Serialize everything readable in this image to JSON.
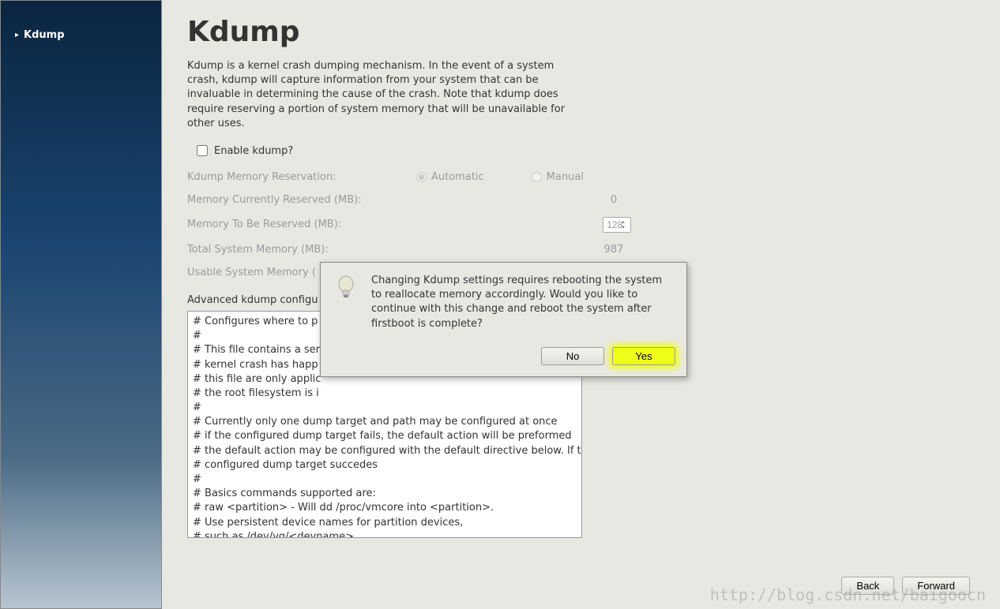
{
  "sidebar": {
    "items": [
      {
        "label": "Kdump"
      }
    ]
  },
  "page": {
    "title": "Kdump",
    "description": "Kdump is a kernel crash dumping mechanism. In the event of a system crash, kdump will capture information from your system that can be invaluable in determining the cause of the crash. Note that kdump does require reserving a portion of system memory that will be unavailable for other uses.",
    "enable_label": "Enable kdump?",
    "rows": {
      "reservation_label": "Kdump Memory Reservation:",
      "auto_label": "Automatic",
      "manual_label": "Manual",
      "current_reserved_label": "Memory Currently Reserved (MB):",
      "current_reserved_value": "0",
      "to_reserve_label": "Memory To Be Reserved (MB):",
      "to_reserve_value": "128",
      "total_memory_label": "Total System Memory (MB):",
      "total_memory_value": "987",
      "usable_memory_label": "Usable System Memory ("
    },
    "advanced_label": "Advanced kdump configu",
    "config_text": "# Configures where to p\n#\n# This file contains a ser\n# kernel crash has happ\n# this file are only applic\n# the root filesystem is i\n#\n# Currently only one dump target and path may be configured at once\n# if the configured dump target fails, the default action will be preformed\n# the default action may be configured with the default directive below.  If th\n# configured dump target succedes\n#\n# Basics commands supported are:\n# raw <partition>    - Will dd /proc/vmcore into <partition>.\n#                      Use persistent device names for partition devices,\n#                      such as /dev/vg/<devname>.\n#\n# nfs <nfs mount>         - Will mount fs and copy /proc/vmcore to\n#                      <mnt>/var/crash/%HOST-%DATE/, supports DNS."
  },
  "dialog": {
    "message": "Changing Kdump settings requires rebooting the system to reallocate memory accordingly. Would you like to continue with this change and reboot the system after firstboot is complete?",
    "no_label": "No",
    "yes_label": "Yes"
  },
  "footer": {
    "back_label": "Back",
    "forward_label": "Forward"
  },
  "watermark": "http://blog.csdn.net/baigoocn"
}
